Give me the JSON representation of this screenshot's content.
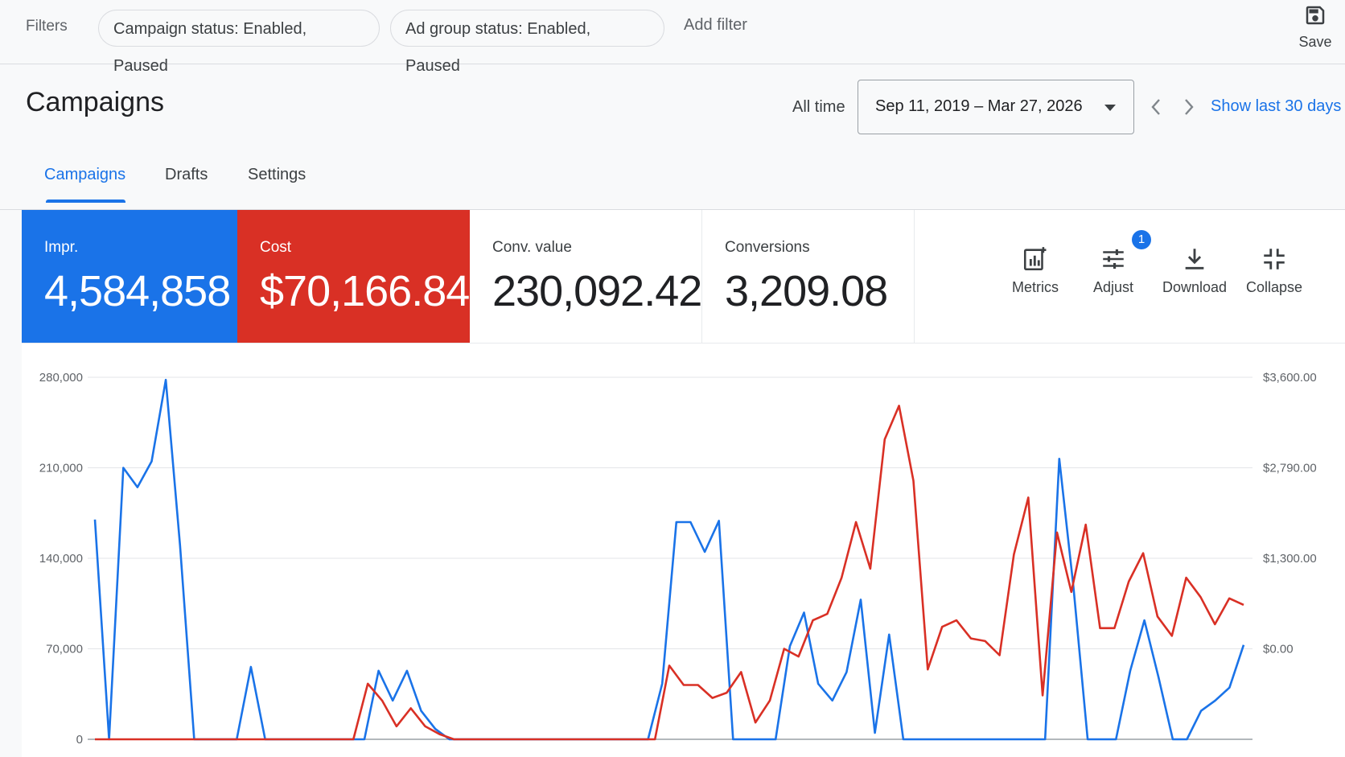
{
  "filter_bar": {
    "filters_label": "Filters",
    "chips": [
      "Campaign status: Enabled, Paused",
      "Ad group status: Enabled, Paused"
    ],
    "add_filter": "Add filter",
    "save_label": "Save"
  },
  "header": {
    "title": "Campaigns",
    "all_time": "All time",
    "date_range": "Sep 11, 2019 – Mar 27, 2026",
    "show_last": "Show last 30 days"
  },
  "tabs": [
    "Campaigns",
    "Drafts",
    "Settings"
  ],
  "scorecards": [
    {
      "label": "Impr.",
      "value": "4,584,858",
      "color": "#1a73e8"
    },
    {
      "label": "Cost",
      "value": "$70,166.84",
      "color": "#d93025"
    },
    {
      "label": "Conv. value",
      "value": "230,092.42"
    },
    {
      "label": "Conversions",
      "value": "3,209.08"
    }
  ],
  "tools": {
    "metrics": "Metrics",
    "adjust": "Adjust",
    "adjust_badge": "1",
    "download": "Download",
    "collapse": "Collapse"
  },
  "icons": [
    "save-icon",
    "chevron-down-icon",
    "chevron-left-icon",
    "chevron-right-icon",
    "metrics-icon",
    "adjust-icon",
    "download-icon",
    "collapse-icon"
  ],
  "chart_data": {
    "type": "line",
    "y_left_ticks": [
      "280,000",
      "210,000",
      "140,000",
      "70,000",
      "0"
    ],
    "y_right_ticks": [
      "$3,600.00",
      "$2,790.00",
      "$1,300.00",
      "$0.00"
    ],
    "y_left_range": [
      0,
      280000
    ],
    "grid": true,
    "series": [
      {
        "color": "#1a73e8",
        "values": [
          170000,
          0,
          210000,
          195000,
          215000,
          278000,
          150000,
          0,
          0,
          0,
          0,
          56000,
          0,
          0,
          0,
          0,
          0,
          0,
          0,
          0,
          53000,
          30000,
          53000,
          22000,
          8000,
          0,
          0,
          0,
          0,
          0,
          0,
          0,
          0,
          0,
          0,
          0,
          0,
          0,
          0,
          0,
          43000,
          168000,
          168000,
          145000,
          169000,
          0,
          0,
          0,
          0,
          72000,
          98000,
          43000,
          30000,
          52000,
          108000,
          5000,
          81000,
          0,
          0,
          0,
          0,
          0,
          0,
          0,
          0,
          0,
          0,
          0,
          217000,
          118000,
          0,
          0,
          0,
          53000,
          92000,
          48000,
          0,
          0,
          22000,
          30000,
          40000,
          73000
        ]
      },
      {
        "color": "#d93025",
        "values": [
          0,
          0,
          0,
          0,
          0,
          0,
          0,
          0,
          0,
          0,
          0,
          0,
          0,
          0,
          0,
          0,
          0,
          0,
          0,
          43000,
          30000,
          10000,
          24000,
          10000,
          4000,
          0,
          0,
          0,
          0,
          0,
          0,
          0,
          0,
          0,
          0,
          0,
          0,
          0,
          0,
          0,
          57000,
          42000,
          42000,
          32000,
          36000,
          52000,
          13000,
          30000,
          70000,
          64000,
          92000,
          97000,
          125000,
          168000,
          132000,
          232000,
          258000,
          200000,
          54000,
          87000,
          92000,
          78000,
          76000,
          65000,
          143000,
          187000,
          34000,
          160000,
          114000,
          166000,
          86000,
          86000,
          122000,
          144000,
          95000,
          80000,
          125000,
          110000,
          89000,
          109000,
          104000
        ]
      }
    ]
  }
}
